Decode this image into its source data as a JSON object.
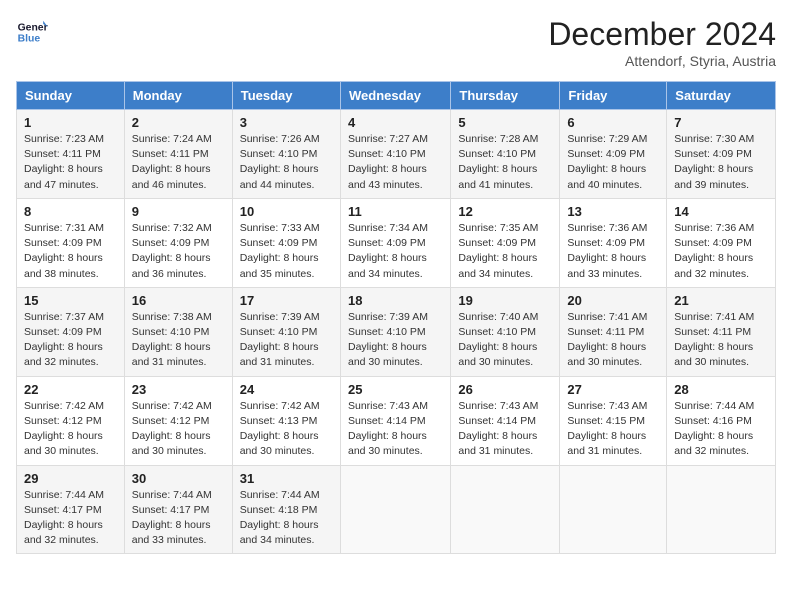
{
  "header": {
    "logo_line1": "General",
    "logo_line2": "Blue",
    "month_year": "December 2024",
    "location": "Attendorf, Styria, Austria"
  },
  "days_of_week": [
    "Sunday",
    "Monday",
    "Tuesday",
    "Wednesday",
    "Thursday",
    "Friday",
    "Saturday"
  ],
  "weeks": [
    [
      {
        "day": "1",
        "sunrise": "Sunrise: 7:23 AM",
        "sunset": "Sunset: 4:11 PM",
        "daylight": "Daylight: 8 hours and 47 minutes."
      },
      {
        "day": "2",
        "sunrise": "Sunrise: 7:24 AM",
        "sunset": "Sunset: 4:11 PM",
        "daylight": "Daylight: 8 hours and 46 minutes."
      },
      {
        "day": "3",
        "sunrise": "Sunrise: 7:26 AM",
        "sunset": "Sunset: 4:10 PM",
        "daylight": "Daylight: 8 hours and 44 minutes."
      },
      {
        "day": "4",
        "sunrise": "Sunrise: 7:27 AM",
        "sunset": "Sunset: 4:10 PM",
        "daylight": "Daylight: 8 hours and 43 minutes."
      },
      {
        "day": "5",
        "sunrise": "Sunrise: 7:28 AM",
        "sunset": "Sunset: 4:10 PM",
        "daylight": "Daylight: 8 hours and 41 minutes."
      },
      {
        "day": "6",
        "sunrise": "Sunrise: 7:29 AM",
        "sunset": "Sunset: 4:09 PM",
        "daylight": "Daylight: 8 hours and 40 minutes."
      },
      {
        "day": "7",
        "sunrise": "Sunrise: 7:30 AM",
        "sunset": "Sunset: 4:09 PM",
        "daylight": "Daylight: 8 hours and 39 minutes."
      }
    ],
    [
      {
        "day": "8",
        "sunrise": "Sunrise: 7:31 AM",
        "sunset": "Sunset: 4:09 PM",
        "daylight": "Daylight: 8 hours and 38 minutes."
      },
      {
        "day": "9",
        "sunrise": "Sunrise: 7:32 AM",
        "sunset": "Sunset: 4:09 PM",
        "daylight": "Daylight: 8 hours and 36 minutes."
      },
      {
        "day": "10",
        "sunrise": "Sunrise: 7:33 AM",
        "sunset": "Sunset: 4:09 PM",
        "daylight": "Daylight: 8 hours and 35 minutes."
      },
      {
        "day": "11",
        "sunrise": "Sunrise: 7:34 AM",
        "sunset": "Sunset: 4:09 PM",
        "daylight": "Daylight: 8 hours and 34 minutes."
      },
      {
        "day": "12",
        "sunrise": "Sunrise: 7:35 AM",
        "sunset": "Sunset: 4:09 PM",
        "daylight": "Daylight: 8 hours and 34 minutes."
      },
      {
        "day": "13",
        "sunrise": "Sunrise: 7:36 AM",
        "sunset": "Sunset: 4:09 PM",
        "daylight": "Daylight: 8 hours and 33 minutes."
      },
      {
        "day": "14",
        "sunrise": "Sunrise: 7:36 AM",
        "sunset": "Sunset: 4:09 PM",
        "daylight": "Daylight: 8 hours and 32 minutes."
      }
    ],
    [
      {
        "day": "15",
        "sunrise": "Sunrise: 7:37 AM",
        "sunset": "Sunset: 4:09 PM",
        "daylight": "Daylight: 8 hours and 32 minutes."
      },
      {
        "day": "16",
        "sunrise": "Sunrise: 7:38 AM",
        "sunset": "Sunset: 4:10 PM",
        "daylight": "Daylight: 8 hours and 31 minutes."
      },
      {
        "day": "17",
        "sunrise": "Sunrise: 7:39 AM",
        "sunset": "Sunset: 4:10 PM",
        "daylight": "Daylight: 8 hours and 31 minutes."
      },
      {
        "day": "18",
        "sunrise": "Sunrise: 7:39 AM",
        "sunset": "Sunset: 4:10 PM",
        "daylight": "Daylight: 8 hours and 30 minutes."
      },
      {
        "day": "19",
        "sunrise": "Sunrise: 7:40 AM",
        "sunset": "Sunset: 4:10 PM",
        "daylight": "Daylight: 8 hours and 30 minutes."
      },
      {
        "day": "20",
        "sunrise": "Sunrise: 7:41 AM",
        "sunset": "Sunset: 4:11 PM",
        "daylight": "Daylight: 8 hours and 30 minutes."
      },
      {
        "day": "21",
        "sunrise": "Sunrise: 7:41 AM",
        "sunset": "Sunset: 4:11 PM",
        "daylight": "Daylight: 8 hours and 30 minutes."
      }
    ],
    [
      {
        "day": "22",
        "sunrise": "Sunrise: 7:42 AM",
        "sunset": "Sunset: 4:12 PM",
        "daylight": "Daylight: 8 hours and 30 minutes."
      },
      {
        "day": "23",
        "sunrise": "Sunrise: 7:42 AM",
        "sunset": "Sunset: 4:12 PM",
        "daylight": "Daylight: 8 hours and 30 minutes."
      },
      {
        "day": "24",
        "sunrise": "Sunrise: 7:42 AM",
        "sunset": "Sunset: 4:13 PM",
        "daylight": "Daylight: 8 hours and 30 minutes."
      },
      {
        "day": "25",
        "sunrise": "Sunrise: 7:43 AM",
        "sunset": "Sunset: 4:14 PM",
        "daylight": "Daylight: 8 hours and 30 minutes."
      },
      {
        "day": "26",
        "sunrise": "Sunrise: 7:43 AM",
        "sunset": "Sunset: 4:14 PM",
        "daylight": "Daylight: 8 hours and 31 minutes."
      },
      {
        "day": "27",
        "sunrise": "Sunrise: 7:43 AM",
        "sunset": "Sunset: 4:15 PM",
        "daylight": "Daylight: 8 hours and 31 minutes."
      },
      {
        "day": "28",
        "sunrise": "Sunrise: 7:44 AM",
        "sunset": "Sunset: 4:16 PM",
        "daylight": "Daylight: 8 hours and 32 minutes."
      }
    ],
    [
      {
        "day": "29",
        "sunrise": "Sunrise: 7:44 AM",
        "sunset": "Sunset: 4:17 PM",
        "daylight": "Daylight: 8 hours and 32 minutes."
      },
      {
        "day": "30",
        "sunrise": "Sunrise: 7:44 AM",
        "sunset": "Sunset: 4:17 PM",
        "daylight": "Daylight: 8 hours and 33 minutes."
      },
      {
        "day": "31",
        "sunrise": "Sunrise: 7:44 AM",
        "sunset": "Sunset: 4:18 PM",
        "daylight": "Daylight: 8 hours and 34 minutes."
      },
      null,
      null,
      null,
      null
    ]
  ]
}
